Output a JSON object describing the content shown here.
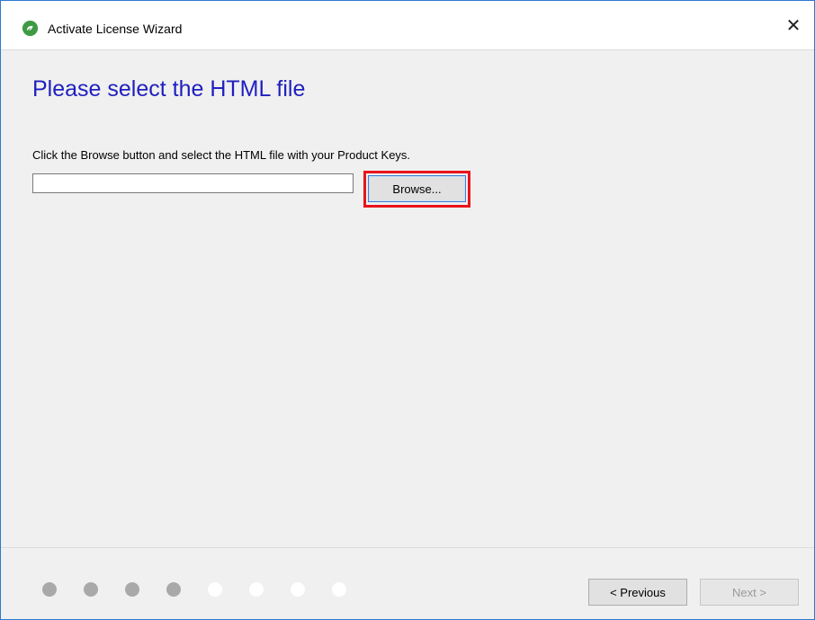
{
  "window": {
    "title": "Activate License Wizard",
    "close_glyph": "✕",
    "icon": "app-logo-icon",
    "border_color": "#2b79d0"
  },
  "page": {
    "heading": "Please select the HTML file",
    "heading_color": "#1f1fbf",
    "instruction": "Click the Browse button and select the HTML file with your Product Keys.",
    "file_path_value": "",
    "browse_label": "Browse...",
    "highlight_color": "#e8141b"
  },
  "footer": {
    "steps_total": 8,
    "steps_completed": 4,
    "previous_label": "< Previous",
    "next_label": "Next >",
    "next_enabled": false
  }
}
